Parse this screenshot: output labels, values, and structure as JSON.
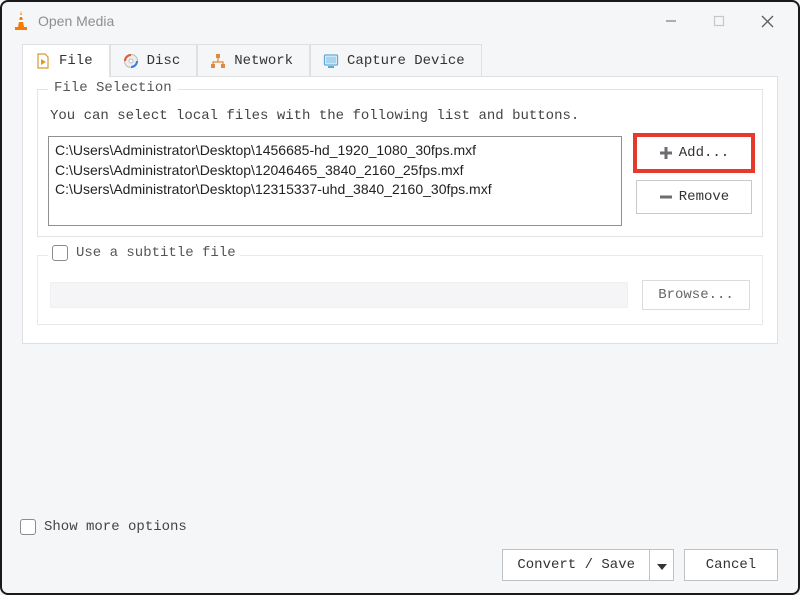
{
  "window": {
    "title": "Open Media"
  },
  "tabs": {
    "file": "File",
    "disc": "Disc",
    "network": "Network",
    "capture": "Capture Device"
  },
  "file_selection": {
    "legend": "File Selection",
    "description": "You can select local files with the following list and buttons.",
    "files": [
      "C:\\Users\\Administrator\\Desktop\\1456685-hd_1920_1080_30fps.mxf",
      "C:\\Users\\Administrator\\Desktop\\12046465_3840_2160_25fps.mxf",
      "C:\\Users\\Administrator\\Desktop\\12315337-uhd_3840_2160_30fps.mxf"
    ],
    "add_label": "Add...",
    "remove_label": "Remove"
  },
  "subtitle": {
    "label": "Use a subtitle file",
    "browse_label": "Browse..."
  },
  "footer": {
    "show_more_label": "Show more options",
    "convert_label": "Convert / Save",
    "cancel_label": "Cancel"
  }
}
